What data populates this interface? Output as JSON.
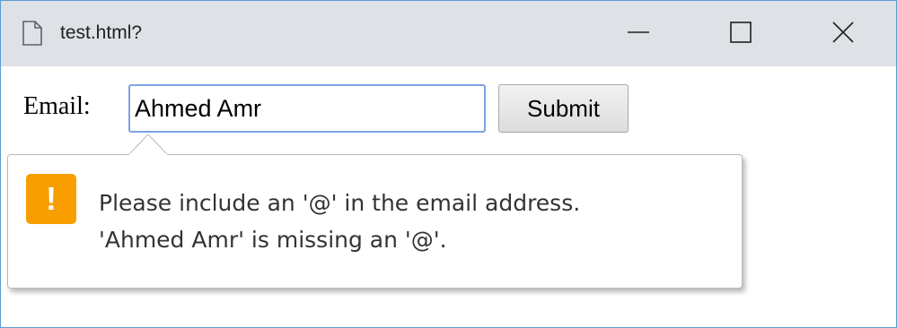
{
  "window": {
    "title": "test.html?"
  },
  "form": {
    "email_label": "Email:",
    "email_value": "Ahmed Amr",
    "submit_label": "Submit"
  },
  "validation": {
    "line1": "Please include an '@' in the email address.",
    "line2": "'Ahmed Amr' is missing an '@'.",
    "icon_glyph": "!",
    "icon_color": "#f89e00"
  },
  "colors": {
    "titlebar": "#dee1e6",
    "window_border": "#5b9bd5",
    "input_focus_border": "#7da2e3"
  }
}
